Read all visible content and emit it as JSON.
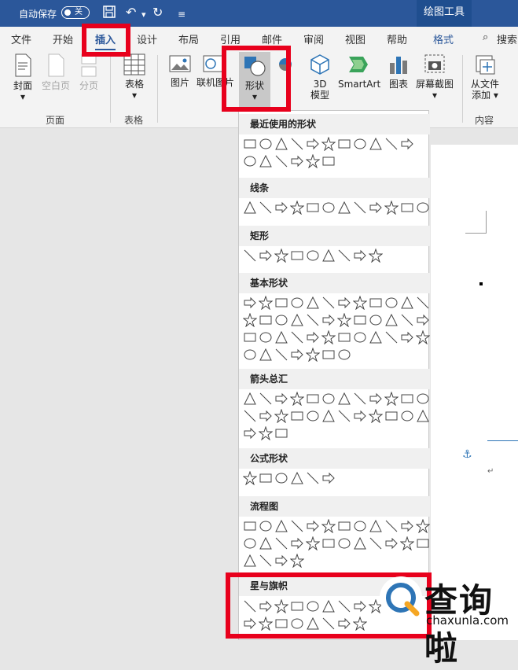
{
  "titlebar": {
    "autosave_label": "自动保存",
    "autosave_state": "关",
    "context_tools": "绘图工具"
  },
  "tabs": [
    {
      "label": "文件"
    },
    {
      "label": "开始"
    },
    {
      "label": "插入"
    },
    {
      "label": "设计"
    },
    {
      "label": "布局"
    },
    {
      "label": "引用"
    },
    {
      "label": "邮件"
    },
    {
      "label": "审阅"
    },
    {
      "label": "视图"
    },
    {
      "label": "帮助"
    },
    {
      "label": "格式"
    }
  ],
  "search_label": "搜索",
  "ribbon": {
    "cover": "封面",
    "blank_page": "空白页",
    "page_break": "分页",
    "group_pages": "页面",
    "table": "表格",
    "group_table": "表格",
    "picture": "图片",
    "online_picture": "联机图片",
    "shapes": "形状",
    "model3d_1": "3D",
    "model3d_2": "模型",
    "smartart": "SmartArt",
    "chart": "图表",
    "screenshot": "屏幕截图",
    "addin_1": "从文件",
    "addin_2": "添加",
    "group_content": "内容"
  },
  "shapes_menu": {
    "sections": [
      {
        "title": "最近使用的形状"
      },
      {
        "title": "线条"
      },
      {
        "title": "矩形"
      },
      {
        "title": "基本形状"
      },
      {
        "title": "箭头总汇"
      },
      {
        "title": "公式形状"
      },
      {
        "title": "流程图"
      },
      {
        "title": "星与旗帜"
      }
    ]
  },
  "watermark": {
    "brand": "查询啦",
    "url": "chaxunla.com"
  },
  "colors": {
    "title_bar": "#2b579a",
    "highlight": "#e8001c",
    "icon_blue": "#2e75b6"
  }
}
